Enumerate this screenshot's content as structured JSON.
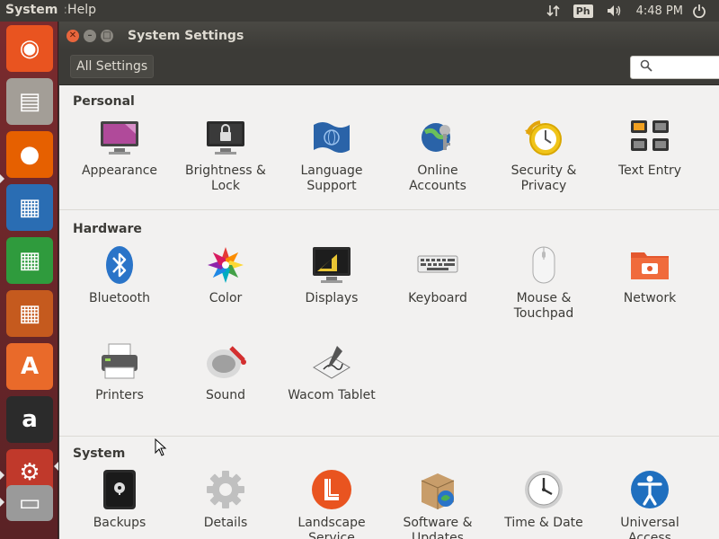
{
  "topbar": {
    "app_menu": "System",
    "separator": ":",
    "help_menu": "Help",
    "keyboard_indicator": "Ph",
    "clock": "4:48 PM",
    "network_icon": "network-transfer-icon",
    "volume_icon": "volume-icon",
    "power_icon": "power-icon"
  },
  "launcher": {
    "items": [
      {
        "name": "ubuntu-dash-icon",
        "glyph": "◉",
        "color": "#e95420"
      },
      {
        "name": "files-icon",
        "glyph": "▤",
        "color": "#a39e97"
      },
      {
        "name": "firefox-icon",
        "glyph": "●",
        "color": "#e66000"
      },
      {
        "name": "libreoffice-writer-icon",
        "glyph": "▦",
        "color": "#2a6db3"
      },
      {
        "name": "libreoffice-calc-icon",
        "glyph": "▦",
        "color": "#2f9b3d"
      },
      {
        "name": "libreoffice-impress-icon",
        "glyph": "▦",
        "color": "#c55a1e"
      },
      {
        "name": "software-center-icon",
        "glyph": "A",
        "color": "#e96a2a"
      },
      {
        "name": "amazon-icon",
        "glyph": "a",
        "color": "#2b2b2b"
      },
      {
        "name": "system-settings-icon",
        "glyph": "⚙",
        "color": "#c0392b"
      },
      {
        "name": "scanner-icon",
        "glyph": "▭",
        "color": "#9a9a9a"
      }
    ]
  },
  "window": {
    "title": "System Settings",
    "all_settings_label": "All Settings",
    "search_placeholder": ""
  },
  "sections": {
    "personal": {
      "title": "Personal",
      "items": [
        {
          "line1": "Appearance",
          "line2": ""
        },
        {
          "line1": "Brightness &",
          "line2": "Lock"
        },
        {
          "line1": "Language",
          "line2": "Support"
        },
        {
          "line1": "Online",
          "line2": "Accounts"
        },
        {
          "line1": "Security &",
          "line2": "Privacy"
        },
        {
          "line1": "Text Entry",
          "line2": ""
        }
      ]
    },
    "hardware": {
      "title": "Hardware",
      "items": [
        {
          "line1": "Bluetooth",
          "line2": ""
        },
        {
          "line1": "Color",
          "line2": ""
        },
        {
          "line1": "Displays",
          "line2": ""
        },
        {
          "line1": "Keyboard",
          "line2": ""
        },
        {
          "line1": "Mouse &",
          "line2": "Touchpad"
        },
        {
          "line1": "Network",
          "line2": ""
        },
        {
          "line1": "Printers",
          "line2": ""
        },
        {
          "line1": "Sound",
          "line2": ""
        },
        {
          "line1": "Wacom Tablet",
          "line2": ""
        }
      ]
    },
    "system": {
      "title": "System",
      "items": [
        {
          "line1": "Backups",
          "line2": ""
        },
        {
          "line1": "Details",
          "line2": ""
        },
        {
          "line1": "Landscape",
          "line2": "Service"
        },
        {
          "line1": "Software &",
          "line2": "Updates"
        },
        {
          "line1": "Time & Date",
          "line2": ""
        },
        {
          "line1": "Universal",
          "line2": "Access"
        }
      ]
    }
  }
}
